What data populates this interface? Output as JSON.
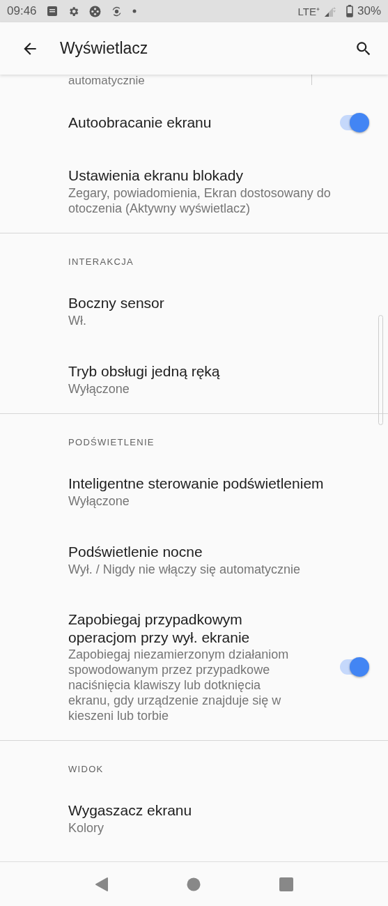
{
  "status_bar": {
    "time": "09:46",
    "network": "LTE⁺",
    "battery": "30%"
  },
  "app_bar": {
    "title": "Wyświetlacz"
  },
  "partial_text": "automatycznie",
  "sections": [
    {
      "items": [
        {
          "kind": "toggle",
          "title": "Autoobracanie ekranu",
          "on": true
        },
        {
          "kind": "text",
          "title": "Ustawienia ekranu blokady",
          "summary": "Zegary, powiadomienia, Ekran dostosowany do otoczenia (Aktywny wyświetlacz)"
        }
      ]
    },
    {
      "header": "INTERAKCJA",
      "items": [
        {
          "kind": "text",
          "title": "Boczny sensor",
          "summary": "Wł."
        },
        {
          "kind": "text",
          "title": "Tryb obsługi jedną ręką",
          "summary": "Wyłączone"
        }
      ]
    },
    {
      "header": "PODŚWIETLENIE",
      "items": [
        {
          "kind": "text",
          "title": "Inteligentne sterowanie podświetleniem",
          "summary": "Wyłączone"
        },
        {
          "kind": "text",
          "title": "Podświetlenie nocne",
          "summary": "Wył. / Nigdy nie włączy się automatycznie"
        },
        {
          "kind": "toggle",
          "title": "Zapobiegaj przypadkowym operacjom przy wył. ekranie",
          "summary": "Zapobiegaj niezamierzonym działaniom spowodowanym przez przypadkowe naciśnięcia klawiszy lub dotknięcia ekranu, gdy urządzenie znajduje się w kieszeni lub torbie",
          "on": true
        }
      ]
    },
    {
      "header": "WIDOK",
      "items": [
        {
          "kind": "text",
          "title": "Wygaszacz ekranu",
          "summary": "Kolory"
        }
      ]
    }
  ]
}
